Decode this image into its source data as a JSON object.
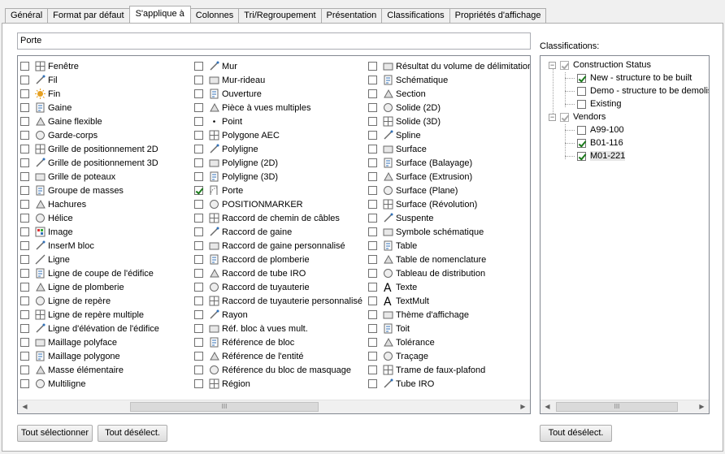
{
  "tabs": [
    "Général",
    "Format par défaut",
    "S'applique à",
    "Colonnes",
    "Tri/Regroupement",
    "Présentation",
    "Classifications",
    "Propriétés d'affichage"
  ],
  "active_tab": 2,
  "filter_value": "Porte",
  "columns": [
    [
      {
        "label": "Fenêtre",
        "icon": "window-icon",
        "checked": false
      },
      {
        "label": "Fil",
        "icon": "wire-icon",
        "checked": false
      },
      {
        "label": "Fin",
        "icon": "end-sun-icon",
        "checked": false
      },
      {
        "label": "Gaine",
        "icon": "duct-icon",
        "checked": false
      },
      {
        "label": "Gaine flexible",
        "icon": "flex-duct-icon",
        "checked": false
      },
      {
        "label": "Garde-corps",
        "icon": "railing-icon",
        "checked": false
      },
      {
        "label": "Grille de positionnement 2D",
        "icon": "grid-2d-icon",
        "checked": false
      },
      {
        "label": "Grille de positionnement 3D",
        "icon": "grid-3d-icon",
        "checked": false
      },
      {
        "label": "Grille de poteaux",
        "icon": "column-grid-icon",
        "checked": false
      },
      {
        "label": "Groupe de masses",
        "icon": "mass-group-icon",
        "checked": false
      },
      {
        "label": "Hachures",
        "icon": "hatch-icon",
        "checked": false
      },
      {
        "label": "Hélice",
        "icon": "helix-icon",
        "checked": false
      },
      {
        "label": "Image",
        "icon": "image-icon",
        "checked": false
      },
      {
        "label": "InserM bloc",
        "icon": "minsert-icon",
        "checked": false
      },
      {
        "label": "Ligne",
        "icon": "line-icon",
        "checked": false
      },
      {
        "label": "Ligne de coupe de l'édifice",
        "icon": "section-line-icon",
        "checked": false
      },
      {
        "label": "Ligne de plomberie",
        "icon": "plumbing-line-icon",
        "checked": false
      },
      {
        "label": "Ligne de repère",
        "icon": "leader-icon",
        "checked": false
      },
      {
        "label": "Ligne de repère multiple",
        "icon": "mleader-icon",
        "checked": false
      },
      {
        "label": "Ligne d'élévation de l'édifice",
        "icon": "elevation-line-icon",
        "checked": false
      },
      {
        "label": "Maillage polyface",
        "icon": "polyface-icon",
        "checked": false
      },
      {
        "label": "Maillage polygone",
        "icon": "polygon-mesh-icon",
        "checked": false
      },
      {
        "label": "Masse élémentaire",
        "icon": "mass-element-icon",
        "checked": false
      },
      {
        "label": "Multiligne",
        "icon": "mline-icon",
        "checked": false
      }
    ],
    [
      {
        "label": "Mur",
        "icon": "wall-icon",
        "checked": false
      },
      {
        "label": "Mur-rideau",
        "icon": "curtain-wall-icon",
        "checked": false
      },
      {
        "label": "Ouverture",
        "icon": "opening-icon",
        "checked": false
      },
      {
        "label": "Pièce à vues multiples",
        "icon": "mv-part-icon",
        "checked": false
      },
      {
        "label": "Point",
        "icon": "point-icon",
        "checked": false
      },
      {
        "label": "Polygone AEC",
        "icon": "aec-polygon-icon",
        "checked": false
      },
      {
        "label": "Polyligne",
        "icon": "polyline-icon",
        "checked": false
      },
      {
        "label": "Polyligne (2D)",
        "icon": "polyline-2d-icon",
        "checked": false
      },
      {
        "label": "Polyligne (3D)",
        "icon": "polyline-3d-icon",
        "checked": false
      },
      {
        "label": "Porte",
        "icon": "door-icon",
        "checked": true
      },
      {
        "label": "POSITIONMARKER",
        "icon": "position-marker-icon",
        "checked": false
      },
      {
        "label": "Raccord de chemin de câbles",
        "icon": "cable-tray-fitting-icon",
        "checked": false
      },
      {
        "label": "Raccord de gaine",
        "icon": "duct-fitting-icon",
        "checked": false
      },
      {
        "label": "Raccord de gaine personnalisé",
        "icon": "custom-duct-fitting-icon",
        "checked": false
      },
      {
        "label": "Raccord de plomberie",
        "icon": "plumbing-fitting-icon",
        "checked": false
      },
      {
        "label": "Raccord de tube IRO",
        "icon": "conduit-fitting-icon",
        "checked": false
      },
      {
        "label": "Raccord de tuyauterie",
        "icon": "pipe-fitting-icon",
        "checked": false
      },
      {
        "label": "Raccord de tuyauterie personnalisé",
        "icon": "custom-pipe-fitting-icon",
        "checked": false
      },
      {
        "label": "Rayon",
        "icon": "ray-icon",
        "checked": false
      },
      {
        "label": "Réf. bloc à vues mult.",
        "icon": "mv-block-ref-icon",
        "checked": false
      },
      {
        "label": "Référence de bloc",
        "icon": "block-ref-icon",
        "checked": false
      },
      {
        "label": "Référence de l'entité",
        "icon": "entity-ref-icon",
        "checked": false
      },
      {
        "label": "Référence du bloc de masquage",
        "icon": "mask-block-ref-icon",
        "checked": false
      },
      {
        "label": "Région",
        "icon": "region-icon",
        "checked": false
      }
    ],
    [
      {
        "label": "Résultat du volume de délimitation",
        "icon": "bounding-volume-icon",
        "checked": false
      },
      {
        "label": "Schématique",
        "icon": "schematic-icon",
        "checked": false
      },
      {
        "label": "Section",
        "icon": "section-icon",
        "checked": false
      },
      {
        "label": "Solide (2D)",
        "icon": "solid-2d-icon",
        "checked": false
      },
      {
        "label": "Solide (3D)",
        "icon": "solid-3d-icon",
        "checked": false
      },
      {
        "label": "Spline",
        "icon": "spline-icon",
        "checked": false
      },
      {
        "label": "Surface",
        "icon": "surface-icon",
        "checked": false
      },
      {
        "label": "Surface (Balayage)",
        "icon": "surface-sweep-icon",
        "checked": false
      },
      {
        "label": "Surface (Extrusion)",
        "icon": "surface-extrude-icon",
        "checked": false
      },
      {
        "label": "Surface (Plane)",
        "icon": "surface-plane-icon",
        "checked": false
      },
      {
        "label": "Surface (Révolution)",
        "icon": "surface-revolve-icon",
        "checked": false
      },
      {
        "label": "Suspente",
        "icon": "hanger-icon",
        "checked": false
      },
      {
        "label": "Symbole schématique",
        "icon": "schematic-symbol-icon",
        "checked": false
      },
      {
        "label": "Table",
        "icon": "table-icon",
        "checked": false
      },
      {
        "label": "Table de nomenclature",
        "icon": "schedule-table-icon",
        "checked": false
      },
      {
        "label": "Tableau de distribution",
        "icon": "panel-board-icon",
        "checked": false
      },
      {
        "label": "Texte",
        "icon": "text-icon",
        "checked": false
      },
      {
        "label": "TextMult",
        "icon": "mtext-icon",
        "checked": false
      },
      {
        "label": "Thème d'affichage",
        "icon": "display-theme-icon",
        "checked": false
      },
      {
        "label": "Toit",
        "icon": "roof-icon",
        "checked": false
      },
      {
        "label": "Tolérance",
        "icon": "tolerance-icon",
        "checked": false
      },
      {
        "label": "Traçage",
        "icon": "trace-icon",
        "checked": false
      },
      {
        "label": "Trame de faux-plafond",
        "icon": "ceiling-grid-icon",
        "checked": false
      },
      {
        "label": "Tube IRO",
        "icon": "conduit-icon",
        "checked": false
      }
    ]
  ],
  "classifications_label": "Classifications:",
  "tree": [
    {
      "label": "Construction Status",
      "state": "partial",
      "children": [
        {
          "label": "New - structure to be built",
          "checked": true
        },
        {
          "label": "Demo - structure to be demolis",
          "checked": false
        },
        {
          "label": "Existing",
          "checked": false
        }
      ]
    },
    {
      "label": "Vendors",
      "state": "partial",
      "children": [
        {
          "label": "A99-100",
          "checked": false
        },
        {
          "label": "B01-116",
          "checked": true
        },
        {
          "label": "M01-221",
          "checked": true,
          "selected": true
        }
      ]
    }
  ],
  "buttons": {
    "select_all": "Tout sélectionner",
    "deselect_all": "Tout désélect.",
    "deselect_all_classif": "Tout désélect."
  },
  "scroll_grip": "III"
}
